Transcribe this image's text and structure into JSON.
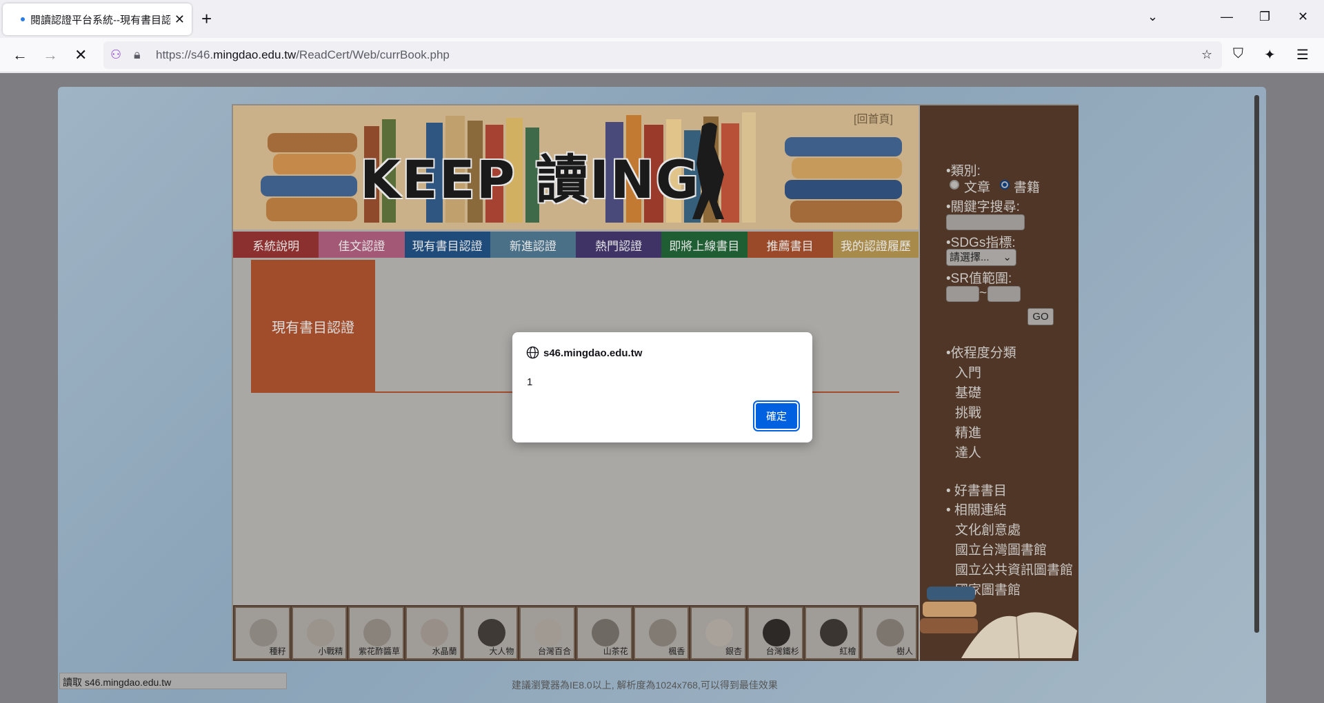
{
  "browser": {
    "tab_title": "閱讀認證平台系統--現有書目認證",
    "url_prefix": "https://s46.",
    "url_domain": "mingdao.edu.tw",
    "url_path": "/ReadCert/Web/currBook.php",
    "status_text": "讀取 s46.mingdao.edu.tw"
  },
  "site": {
    "banner_title": "KEEP 讀ING",
    "home_link": "[回首頁]",
    "menu": [
      {
        "label": "系統說明",
        "color": "#8c2f2f"
      },
      {
        "label": "佳文認證",
        "color": "#a35876"
      },
      {
        "label": "現有書目認證",
        "color": "#1e4b7a"
      },
      {
        "label": "新進認證",
        "color": "#4a7088"
      },
      {
        "label": "熱門認證",
        "color": "#3f3366"
      },
      {
        "label": "即將上線書目",
        "color": "#1f5e33"
      },
      {
        "label": "推薦書目",
        "color": "#9a4a28"
      },
      {
        "label": "我的認證履歷",
        "color": "#a88a4a"
      }
    ],
    "section_label": "現有書目認證",
    "plants": [
      "種籽",
      "小戰精",
      "紫花酢醬草",
      "水晶蘭",
      "大人物",
      "台灣百合",
      "山茶花",
      "楓香",
      "銀杏",
      "台灣鐵杉",
      "紅檜",
      "樹人"
    ],
    "footer_text": "建議瀏覽器為IE8.0以上, 解析度為1024x768,可以得到最佳效果"
  },
  "sidebar": {
    "category_label": "•類別:",
    "option_article": "文章",
    "option_book": "書籍",
    "keyword_label": "•關鍵字搜尋:",
    "sdgs_label": "•SDGs指標:",
    "sdgs_selected": "請選擇...",
    "sr_label": "•SR值範圍:",
    "sr_sep": "~",
    "go_label": "GO",
    "level_header": "•依程度分類",
    "levels": [
      "入門",
      "基礎",
      "挑戰",
      "精進",
      "達人"
    ],
    "good_books": "• 好書書目",
    "links_header": "• 相關連結",
    "links": [
      "文化創意處",
      "國立台灣圖書館",
      "國立公共資訊圖書館",
      "國家圖書館"
    ]
  },
  "dialog": {
    "origin": "s46.mingdao.edu.tw",
    "message": "1",
    "ok_label": "確定"
  }
}
